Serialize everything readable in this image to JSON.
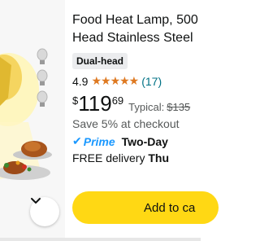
{
  "product": {
    "title_line1": "Food Heat Lamp, 500",
    "title_line2": "Head Stainless Steel",
    "badge": "Dual-head",
    "rating": "4.9",
    "stars": "★★★★★",
    "review_count": "(17)",
    "price_currency": "$",
    "price_whole": "119",
    "price_fraction": "69",
    "typical_label": "Typical:",
    "typical_price": "$135",
    "save_text": "Save 5% at checkout",
    "prime_check": "✔",
    "prime_label": "Prime",
    "delivery_type": "Two-Day",
    "delivery_prefix": "FREE delivery",
    "delivery_day": "Thu",
    "add_to_cart": "Add to ca"
  },
  "colors": {
    "star": "#de7921",
    "link": "#007185",
    "prime": "#1a98ff",
    "add_button": "#ffd814"
  },
  "icons": {
    "scroll": "chevron-down-icon",
    "product_image": "heat-lamp-food-image"
  }
}
